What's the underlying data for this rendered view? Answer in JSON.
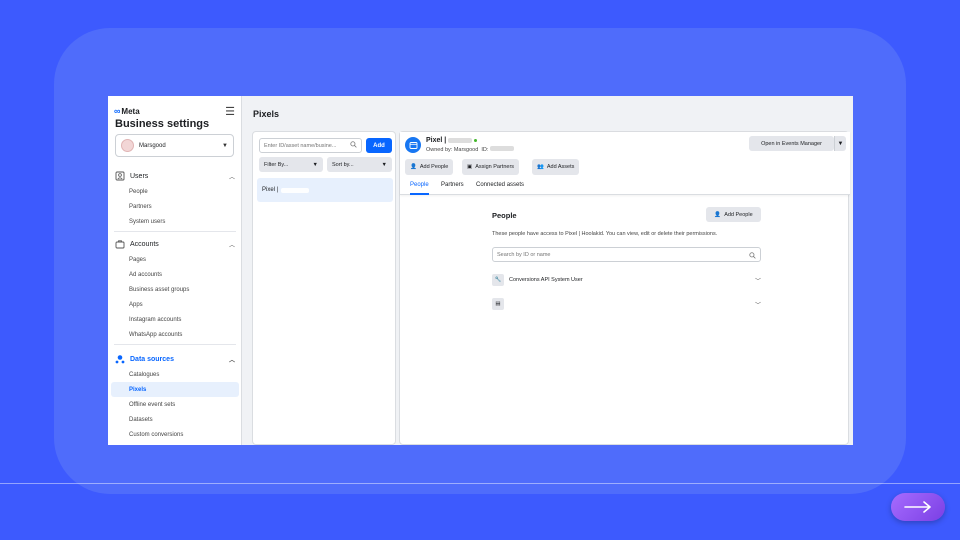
{
  "sidebar": {
    "logo": "Meta",
    "title": "Business settings",
    "account": "Marsgood",
    "groups": [
      {
        "label": "Users",
        "items": [
          "People",
          "Partners",
          "System users"
        ]
      },
      {
        "label": "Accounts",
        "items": [
          "Pages",
          "Ad accounts",
          "Business asset groups",
          "Apps",
          "Instagram accounts",
          "WhatsApp accounts"
        ]
      },
      {
        "label": "Data sources",
        "items": [
          "Catalogues",
          "Pixels",
          "Offline event sets",
          "Datasets",
          "Custom conversions"
        ]
      }
    ],
    "selected_item": "Pixels"
  },
  "page_title": "Pixels",
  "list": {
    "search_placeholder": "Enter ID/asset name/busine...",
    "add_label": "Add",
    "filter_label": "Filter By...",
    "sort_label": "Sort by...",
    "item_label": "Pixel |"
  },
  "detail": {
    "name": "Pixel |",
    "owned_by": "Owned by: Marsgood",
    "id_label": "ID:",
    "open_events_label": "Open in Events Manager",
    "actions": [
      "Add People",
      "Assign Partners",
      "Add Assets"
    ],
    "tabs": [
      "People",
      "Partners",
      "Connected assets"
    ],
    "active_tab": "People",
    "people": {
      "title": "People",
      "add_label": "Add People",
      "description": "These people have access to Pixel | Hoolakid. You can view, edit or delete their permissions.",
      "search_placeholder": "Search by ID or name",
      "rows": [
        "Conversions API System User",
        ""
      ]
    }
  },
  "colors": {
    "background": "#3d5afe",
    "accent": "#0866ff",
    "next_button": "#8b4ff0"
  },
  "icons": {
    "next": "arrow-right-icon"
  }
}
